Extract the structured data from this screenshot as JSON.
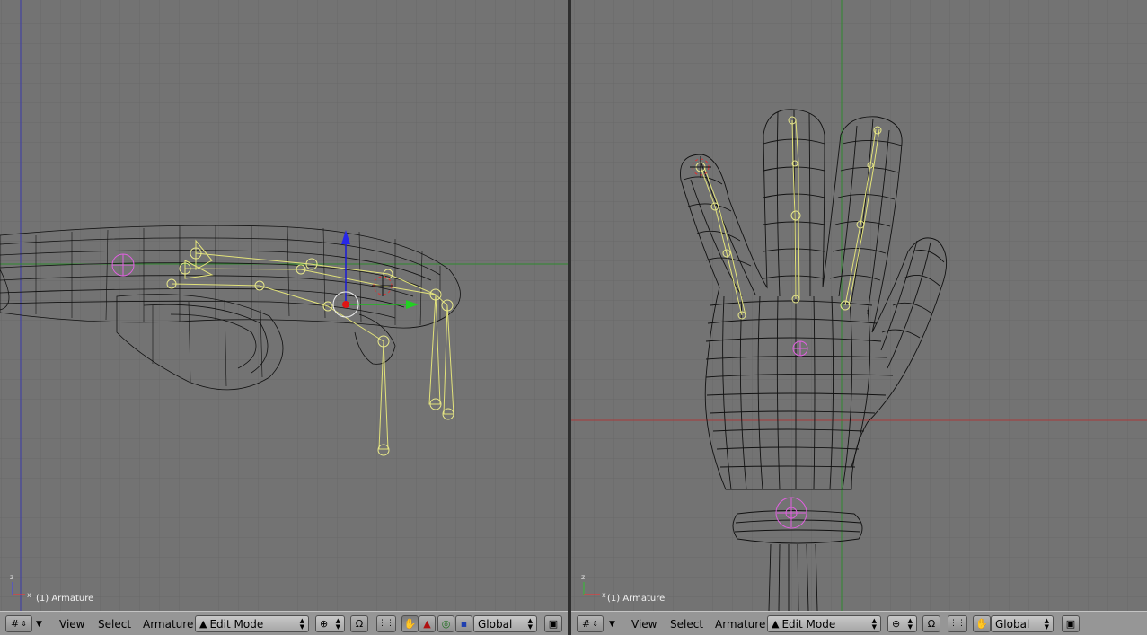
{
  "left_viewport": {
    "object_label": "(1) Armature",
    "axis_labels": [
      "z",
      "x"
    ],
    "colors": {
      "background": "#737373",
      "grid": "#6a6a6a",
      "mesh": "#111111",
      "bones": "#e6e67a"
    }
  },
  "right_viewport": {
    "object_label": "(1) Armature",
    "axis_labels": [
      "z",
      "x"
    ],
    "colors": {
      "background": "#737373",
      "grid": "#6a6a6a",
      "mesh": "#111111",
      "bones": "#e6e67a"
    }
  },
  "header_left": {
    "view_label": "View",
    "select_label": "Select",
    "armature_label": "Armature",
    "mode_value": "Edit Mode",
    "orientation_value": "Global"
  },
  "header_right": {
    "view_label": "View",
    "select_label": "Select",
    "armature_label": "Armature",
    "mode_value": "Edit Mode",
    "orientation_value": "Global"
  },
  "icons": [
    "viewport-type-icon",
    "menu-collapse-icon",
    "mode-icon",
    "pivot-icon",
    "snap-magnet-icon",
    "grab-icon",
    "rotate-icon",
    "scale-icon",
    "render-icon"
  ]
}
